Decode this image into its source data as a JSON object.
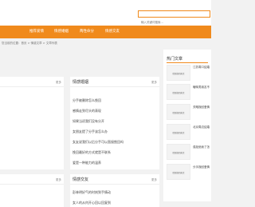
{
  "search": {
    "placeholder": "输入关键词搜索..."
  },
  "nav": [
    {
      "label": "推荐爱情"
    },
    {
      "label": "情感婚姻"
    },
    {
      "label": "两性命分"
    },
    {
      "label": "情感交友"
    }
  ],
  "breadcrumb": "您当前的位置：首页 > 情感文章 > 文章列表",
  "panels": {
    "top_left": {
      "title": "",
      "more": "更多",
      "items": [
        "",
        "",
        "",
        "",
        "",
        "",
        ""
      ]
    },
    "top_mid": {
      "title": "情感婚姻",
      "more": "更多",
      "items": [
        "分手被删除怎么挽回",
        "感情走到尽头的表现",
        "如果当初我们没有分开",
        "女朋友提了分手该怎么办",
        "女友说我们以后分手可以直接挽回吗",
        "挽回最好的方式就是不联系",
        "爱是一种能力的温养"
      ]
    },
    "bottom_left": {
      "title": "",
      "more": "更多",
      "items": [
        "",
        ""
      ]
    },
    "bottom_mid": {
      "title": "情感交友",
      "more": "更多",
      "items": [
        "彭林明好气的时刻到手情动",
        "女人的从何开心回以回复到"
      ]
    }
  },
  "hot": {
    "title": "热门文章",
    "thumb_label": "情感挽回热文",
    "items": [
      "江苏周口结婚",
      "暧昧男朋友不",
      "关略挽回爱情",
      "北京周边结婚",
      "强拒绝我了怎",
      "分手挽回爱情"
    ]
  }
}
